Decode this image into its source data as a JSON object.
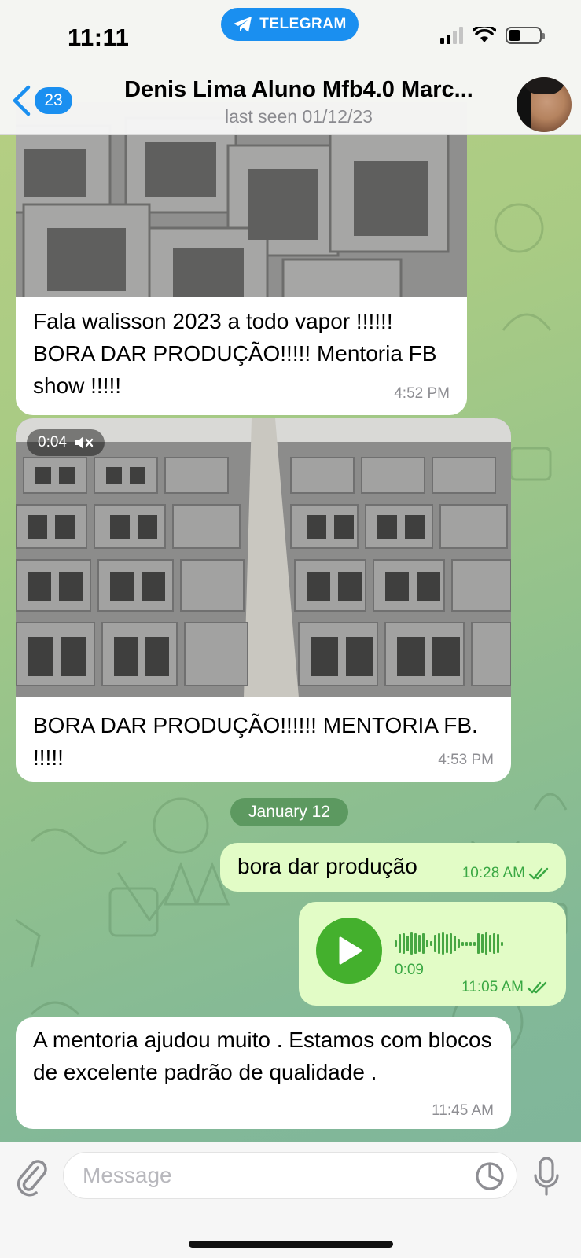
{
  "status_bar": {
    "time": "11:11",
    "app_pill": "TELEGRAM"
  },
  "header": {
    "back_count": "23",
    "title": "Denis Lima Aluno Mfb4.0 Marc...",
    "subtitle": "last seen 01/12/23"
  },
  "messages": [
    {
      "direction": "incoming",
      "type": "photo",
      "text": "Fala walisson 2023 a todo vapor !!!!!! BORA DAR PRODUÇÃO!!!!! Mentoria FB show !!!!!",
      "time": "4:52 PM"
    },
    {
      "direction": "incoming",
      "type": "video",
      "video_duration": "0:04",
      "text": "BORA DAR PRODUÇÃO!!!!!! MENTORIA FB. !!!!!",
      "time": "4:53 PM"
    },
    {
      "direction": "outgoing",
      "type": "text",
      "text": "bora dar produção",
      "time": "10:28 AM"
    },
    {
      "direction": "outgoing",
      "type": "voice",
      "duration": "0:09",
      "time": "11:05 AM"
    },
    {
      "direction": "incoming",
      "type": "text",
      "text": "A mentoria ajudou muito . Estamos com blocos de excelente padrão de qualidade .",
      "time": "11:45 AM"
    }
  ],
  "date_separator": "January 12",
  "input": {
    "placeholder": "Message"
  },
  "colors": {
    "accent": "#1a8ff0",
    "outgoing_bubble": "#e2fcc6",
    "play_button": "#44b02d",
    "read_check": "#3aa843"
  },
  "icons": [
    "telegram-icon",
    "back-chevron-icon",
    "signal-icon",
    "wifi-icon",
    "battery-icon",
    "mute-icon",
    "play-icon",
    "double-check-icon",
    "attach-icon",
    "sticker-icon",
    "mic-icon"
  ]
}
